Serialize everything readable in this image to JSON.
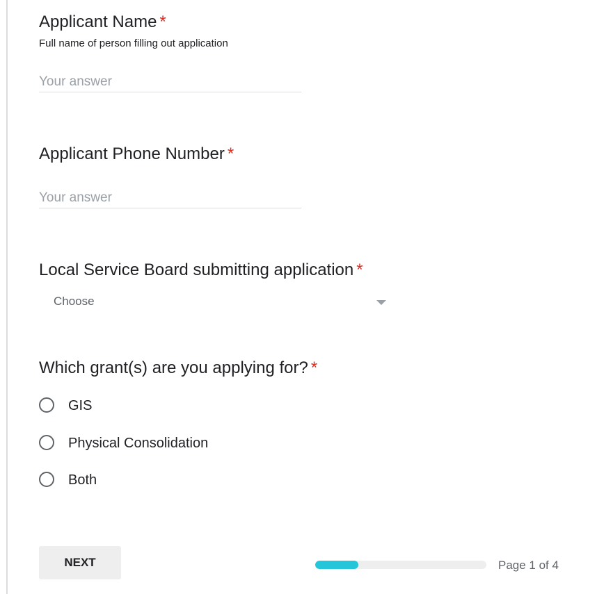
{
  "required_marker": "*",
  "questions": [
    {
      "title": "Applicant Name",
      "help": "Full name of person filling out application",
      "placeholder": "Your answer"
    },
    {
      "title": "Applicant Phone Number",
      "placeholder": "Your answer"
    },
    {
      "title": "Local Service Board submitting application",
      "selected": "Choose"
    },
    {
      "title": "Which grant(s) are you applying for?",
      "options": [
        "GIS",
        "Physical Consolidation",
        "Both"
      ]
    }
  ],
  "footer": {
    "next_label": "NEXT",
    "page_label": "Page 1 of 4",
    "progress_fraction": 0.25
  },
  "colors": {
    "required": "#d93025",
    "progress": "#26c6da",
    "button_bg": "#eeeeee"
  }
}
